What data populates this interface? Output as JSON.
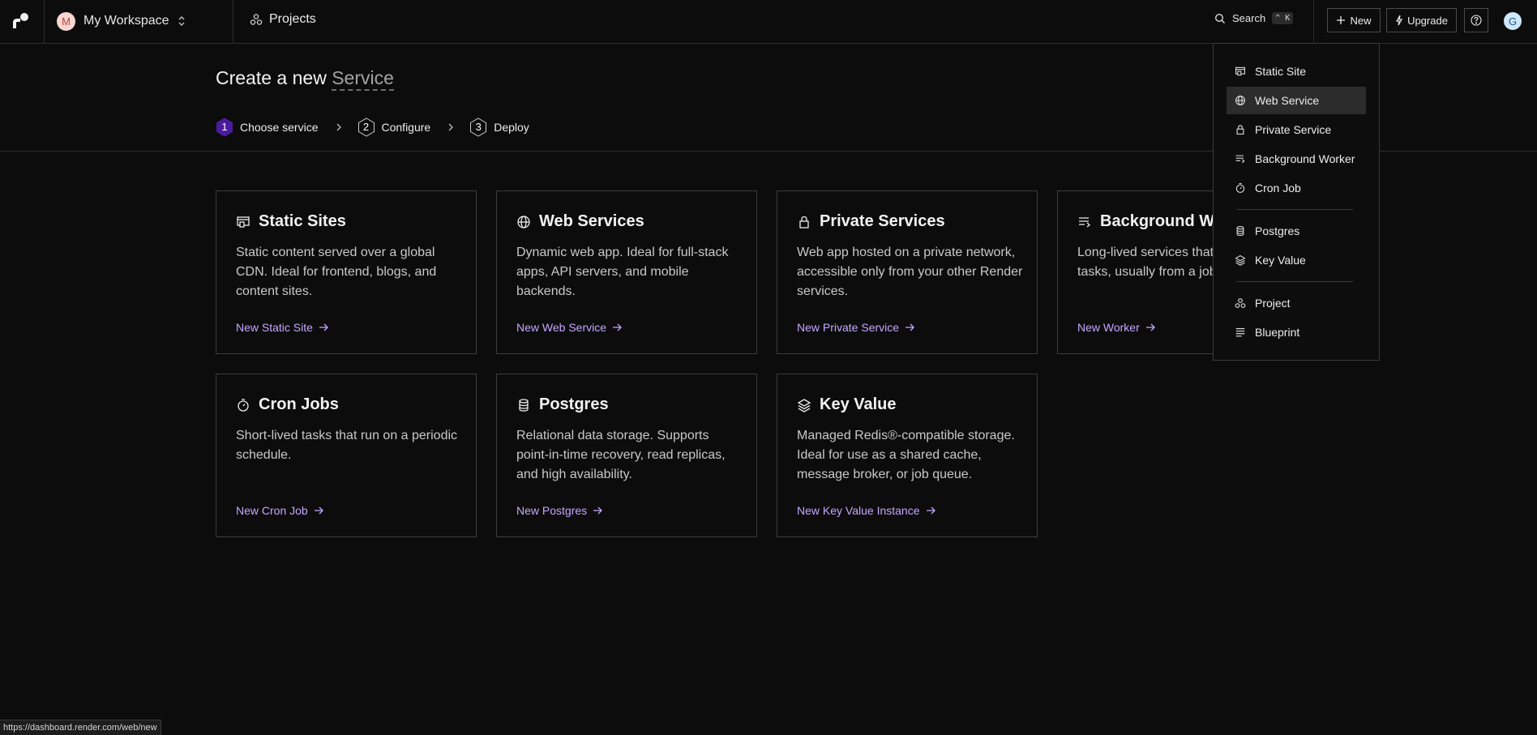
{
  "colors": {
    "background": "#0c0c0c",
    "accent_link": "#c3a7ff",
    "active_step": "#4b1b9e",
    "menu_active": "#2c2c2c"
  },
  "topbar": {
    "workspace": {
      "avatar_letter": "M",
      "name": "My Workspace"
    },
    "projects_label": "Projects",
    "search": {
      "label": "Search",
      "shortcut": "^ K"
    },
    "new_label": "New",
    "upgrade_label": "Upgrade",
    "help_icon": "question-circle-icon",
    "user_avatar_letter": "G"
  },
  "page": {
    "title_prefix": "Create a new",
    "title_accent": "Service"
  },
  "steps": [
    {
      "number": "1",
      "label": "Choose service",
      "active": true
    },
    {
      "number": "2",
      "label": "Configure",
      "active": false
    },
    {
      "number": "3",
      "label": "Deploy",
      "active": false
    }
  ],
  "cards": [
    {
      "icon": "static-site-icon",
      "title": "Static Sites",
      "description": "Static content served over a global CDN. Ideal for frontend, blogs, and content sites.",
      "link": "New Static Site"
    },
    {
      "icon": "globe-icon",
      "title": "Web Services",
      "description": "Dynamic web app. Ideal for full-stack apps, API servers, and mobile backends.",
      "link": "New Web Service"
    },
    {
      "icon": "lock-icon",
      "title": "Private Services",
      "description": "Web app hosted on a private network, accessible only from your other Render services.",
      "link": "New Private Service"
    },
    {
      "icon": "background-worker-icon",
      "title": "Background Workers",
      "description": "Long-lived services that process async tasks, usually from a job queue.",
      "link": "New Worker"
    },
    {
      "icon": "timer-icon",
      "title": "Cron Jobs",
      "description": "Short-lived tasks that run on a periodic schedule.",
      "link": "New Cron Job"
    },
    {
      "icon": "database-icon",
      "title": "Postgres",
      "description": "Relational data storage. Supports point-in-time recovery, read replicas, and high availability.",
      "link": "New Postgres"
    },
    {
      "icon": "layers-icon",
      "title": "Key Value",
      "description": "Managed Redis®-compatible storage. Ideal for use as a shared cache, message broker, or job queue.",
      "link": "New Key Value Instance"
    }
  ],
  "new_menu": {
    "group_services": [
      {
        "icon": "static-site-icon",
        "label": "Static Site"
      },
      {
        "icon": "globe-icon",
        "label": "Web Service",
        "highlighted": true
      },
      {
        "icon": "lock-icon",
        "label": "Private Service"
      },
      {
        "icon": "background-worker-icon",
        "label": "Background Worker"
      },
      {
        "icon": "timer-icon",
        "label": "Cron Job"
      }
    ],
    "group_data": [
      {
        "icon": "database-icon",
        "label": "Postgres"
      },
      {
        "icon": "layers-icon",
        "label": "Key Value"
      }
    ],
    "group_other": [
      {
        "icon": "project-icon",
        "label": "Project"
      },
      {
        "icon": "blueprint-icon",
        "label": "Blueprint"
      }
    ]
  },
  "status_url": "https://dashboard.render.com/web/new"
}
